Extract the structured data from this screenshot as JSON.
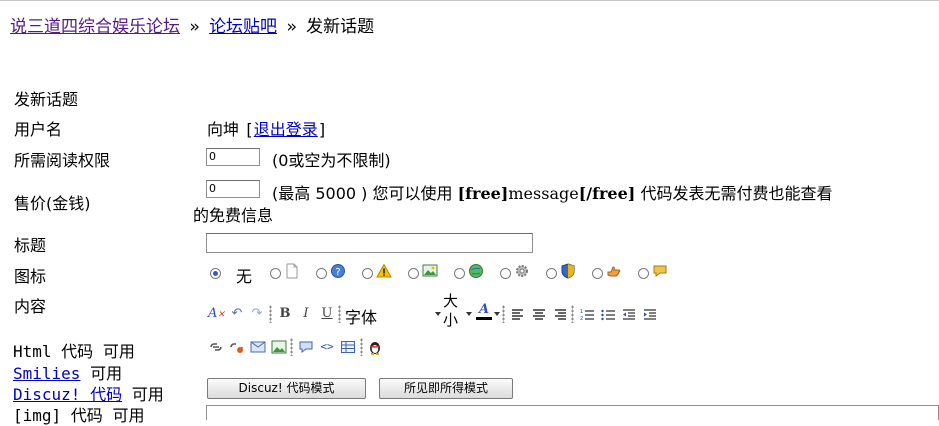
{
  "breadcrumb": {
    "forum_home": "说三道四综合娱乐论坛",
    "separator": "»",
    "forum_posts": "论坛贴吧",
    "current": "发新话题"
  },
  "form": {
    "heading": "发新话题",
    "username_label": "用户名",
    "username_value": "向坤",
    "logout_open": "[",
    "logout_link": "退出登录",
    "logout_close": "]",
    "read_perm_label": "所需阅读权限",
    "read_perm_value": "0",
    "read_perm_hint": "(0或空为不限制)",
    "price_label": "售价(金钱)",
    "price_value": "0",
    "price_hint_line1": "(最高 5000 ) 您可以使用",
    "price_free_open": "[free]",
    "price_message": "message",
    "price_free_close": "[/free]",
    "price_hint_tail": "代码发表无需付费也能查看",
    "price_hint_line2": "的免费信息",
    "title_label": "标题",
    "title_value": "",
    "icon_label": "图标",
    "icon_none": "无",
    "content_label": "内容"
  },
  "editor": {
    "font_label": "字体",
    "size_label_top": "大",
    "size_label_bottom": "小",
    "mode_discuz": "Discuz! 代码模式",
    "mode_wysiwyg": "所见即所得模式"
  },
  "sidebar_info": {
    "html_label": "Html 代码",
    "html_state": "可用",
    "smilies_link": "Smilies",
    "smilies_state": "可用",
    "discuz_link": "Discuz! 代码",
    "discuz_state": "可用",
    "img_label": "[img] 代码",
    "img_state": "可用"
  },
  "colors": {
    "visited_link": "#551a8b",
    "link": "#0000cc",
    "radio_selected": "#2a5bd7"
  }
}
